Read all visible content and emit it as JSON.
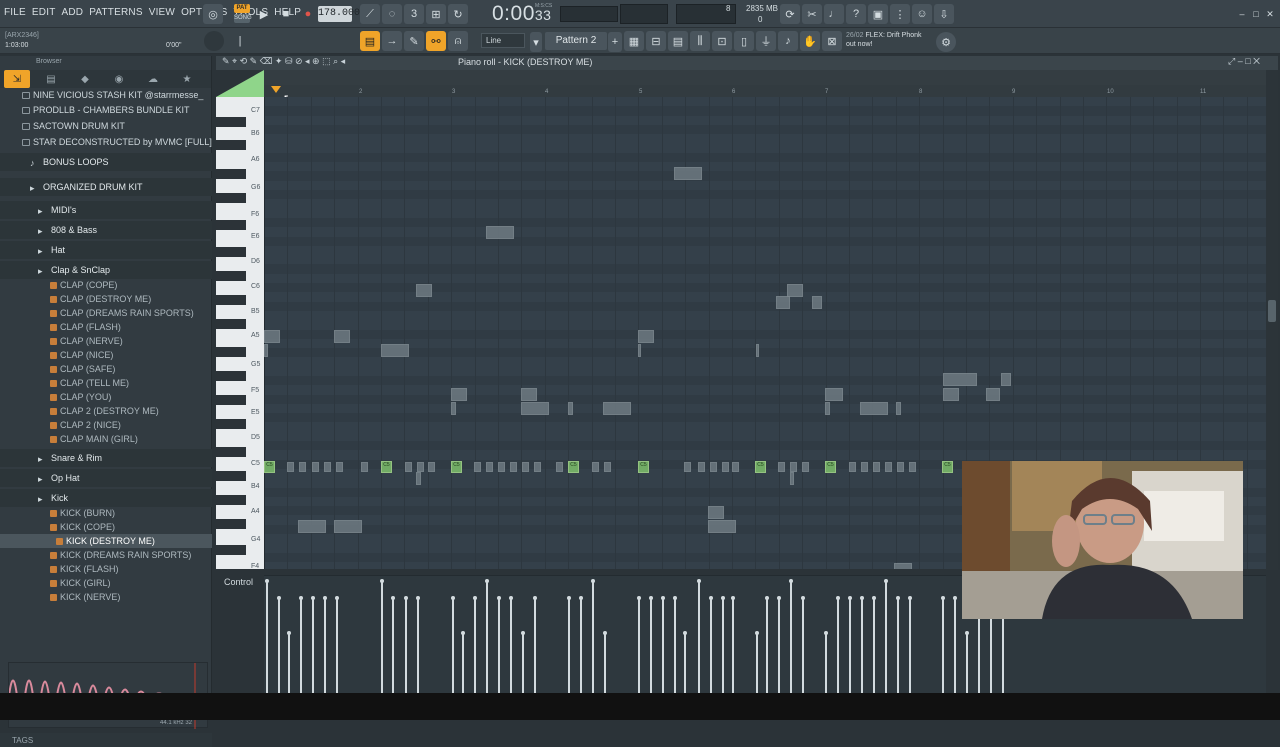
{
  "menu": [
    "FILE",
    "EDIT",
    "ADD",
    "PATTERNS",
    "VIEW",
    "OPTIONS",
    "TOOLS",
    "HELP"
  ],
  "transport": {
    "pat_label": "PAT",
    "song_label": "SONG",
    "tempo": "178.000",
    "time": "0:00",
    "time_sub": "33",
    "time_unit_label": "M:S:CS",
    "memory": "2835 MB",
    "cpu": "8",
    "polyphony": "0"
  },
  "hint": {
    "line1": "[ARX2346]",
    "line2": "1:03:00",
    "line3": "0'00\""
  },
  "toolbar2": {
    "snap": "Line",
    "pattern": "Pattern 2",
    "news_date": "26/02",
    "news_line1": "FLEX: Drift Phonk",
    "news_line2": "out now!"
  },
  "browser": {
    "title": "Browser",
    "items": [
      {
        "label": "NINE VICIOUS STASH KIT @starrmesse_",
        "kind": "folder"
      },
      {
        "label": "PRODLLB - CHAMBERS BUNDLE KIT",
        "kind": "folder"
      },
      {
        "label": "SACTOWN DRUM KIT",
        "kind": "folder"
      },
      {
        "label": "STAR DECONSTRUCTED by MVMC [FULL]",
        "kind": "folder"
      },
      {
        "label": "BONUS LOOPS",
        "kind": "cat"
      },
      {
        "label": "ORGANIZED DRUM KIT",
        "kind": "cat"
      },
      {
        "label": "MIDI's",
        "kind": "cat"
      },
      {
        "label": "808 & Bass",
        "kind": "cat"
      },
      {
        "label": "Hat",
        "kind": "cat"
      },
      {
        "label": "Clap & SnClap",
        "kind": "cat"
      },
      {
        "label": "CLAP (COPE)",
        "kind": "file"
      },
      {
        "label": "CLAP (DESTROY ME)",
        "kind": "file"
      },
      {
        "label": "CLAP (DREAMS RAIN SPORTS)",
        "kind": "file"
      },
      {
        "label": "CLAP (FLASH)",
        "kind": "file"
      },
      {
        "label": "CLAP (NERVE)",
        "kind": "file"
      },
      {
        "label": "CLAP (NICE)",
        "kind": "file"
      },
      {
        "label": "CLAP (SAFE)",
        "kind": "file"
      },
      {
        "label": "CLAP (TELL ME)",
        "kind": "file"
      },
      {
        "label": "CLAP (YOU)",
        "kind": "file"
      },
      {
        "label": "CLAP 2 (DESTROY ME)",
        "kind": "file"
      },
      {
        "label": "CLAP 2 (NICE)",
        "kind": "file"
      },
      {
        "label": "CLAP MAIN (GIRL)",
        "kind": "file"
      },
      {
        "label": "Snare & Rim",
        "kind": "cat"
      },
      {
        "label": "Op Hat",
        "kind": "cat"
      },
      {
        "label": "Kick",
        "kind": "cat"
      },
      {
        "label": "KICK (BURN)",
        "kind": "file"
      },
      {
        "label": "KICK (COPE)",
        "kind": "file"
      },
      {
        "label": "KICK (DESTROY ME)",
        "kind": "file",
        "selected": true
      },
      {
        "label": "KICK (DREAMS RAIN SPORTS)",
        "kind": "file"
      },
      {
        "label": "KICK (FLASH)",
        "kind": "file"
      },
      {
        "label": "KICK (GIRL)",
        "kind": "file"
      },
      {
        "label": "KICK (NERVE)",
        "kind": "file"
      }
    ],
    "wave_info": "44.1 kHz 32",
    "tags": "TAGS"
  },
  "piano_roll": {
    "title": "Piano roll - KICK (DESTROY ME)",
    "bar_numbers": [
      "2",
      "3",
      "4",
      "5",
      "6",
      "7",
      "8",
      "9",
      "10",
      "11"
    ],
    "key_labels": [
      "C7",
      "B6",
      "A6",
      "G6",
      "F6",
      "E6",
      "D6",
      "C6",
      "B5",
      "A5",
      "G5",
      "F5",
      "E5",
      "D5",
      "C5",
      "B4",
      "A4",
      "G4",
      "F4"
    ],
    "note_label": "C5",
    "control_label": "Control"
  },
  "colors": {
    "accent": "#f0a429",
    "note": "#6e7a82",
    "kick_note": "#7dbf6b"
  }
}
